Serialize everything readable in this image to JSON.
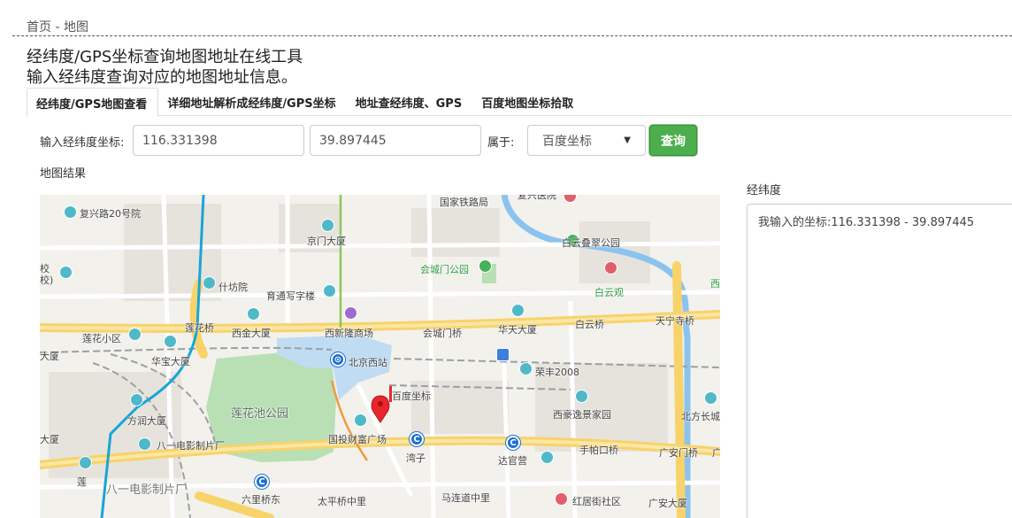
{
  "breadcrumb": "首页 - 地图",
  "page": {
    "title": "经纬度/GPS坐标查询地图地址在线工具",
    "subtitle": "输入经纬度查询对应的地图地址信息。"
  },
  "tabs": [
    {
      "label": "经纬度/GPS地图查看",
      "active": true
    },
    {
      "label": "详细地址解析成经纬度/GPS坐标",
      "active": false
    },
    {
      "label": "地址查经纬度、GPS",
      "active": false
    },
    {
      "label": "百度地图坐标拾取",
      "active": false
    }
  ],
  "form": {
    "coord_label": "输入经纬度坐标:",
    "lng_value": "116.331398",
    "lat_value": "39.897445",
    "belongs_label": "属于:",
    "coord_type": "百度坐标",
    "query_label": "查询"
  },
  "map_result_label": "地图结果",
  "map": {
    "labels": {
      "fuxinglu": "复兴路20号院",
      "guojia": "国家铁路局",
      "fuxing_hospital": "复兴医院",
      "jingmen": "京门大厦",
      "baiyun_garden": "白云叠翠公园",
      "huichengmen_park": "会城门公园",
      "baiyunguan": "白云观",
      "shifangyuan": "什坊院",
      "yutong": "育通写字楼",
      "xiao": "校",
      "xiao2": "校)",
      "xi": "西",
      "lianhuaqiao": "莲花桥",
      "xijin": "西金大厦",
      "xixinlong": "西新隆商场",
      "huichengmenqiao": "会城门桥",
      "huatian": "华天大厦",
      "baiyunqiao": "白云桥",
      "tianningsi": "天宁寺桥",
      "lianhua_xiaoqu": "莲花小区",
      "da": "大厦",
      "huabao": "华宝大厦",
      "beijingxi": "北京西站",
      "rongfeng": "荣丰2008",
      "lianhuachi": "莲花池公园",
      "baidu_marker": "百度坐标",
      "fangrun": "方润大厦",
      "xihaoyi": "西豪逸景家园",
      "beifang": "北方长城",
      "guotou": "国投财富广场",
      "bayi": "八一电影制片厂",
      "shoupakou": "手帕口桥",
      "guanganmen": "广安门桥",
      "guang": "广",
      "wanzi": "湾子",
      "dacanying": "达官营",
      "bayi2": "八一电影制片厂",
      "lian": "莲",
      "liuliqiao": "六里桥东",
      "taipingqiao": "太平桥中里",
      "maliandao": "马连道中里",
      "hongmian": "红居街社区",
      "guanganmen_d": "广安大厦"
    }
  },
  "side": {
    "label": "经纬度",
    "result": "我输入的坐标:116.331398 - 39.897445"
  },
  "colors": {
    "accent_green": "#4cae4c",
    "road_yellow": "#fcd86a",
    "water_blue": "#b5d7f2",
    "park_green": "#b7dcb0",
    "marker_red": "#e8262c"
  }
}
